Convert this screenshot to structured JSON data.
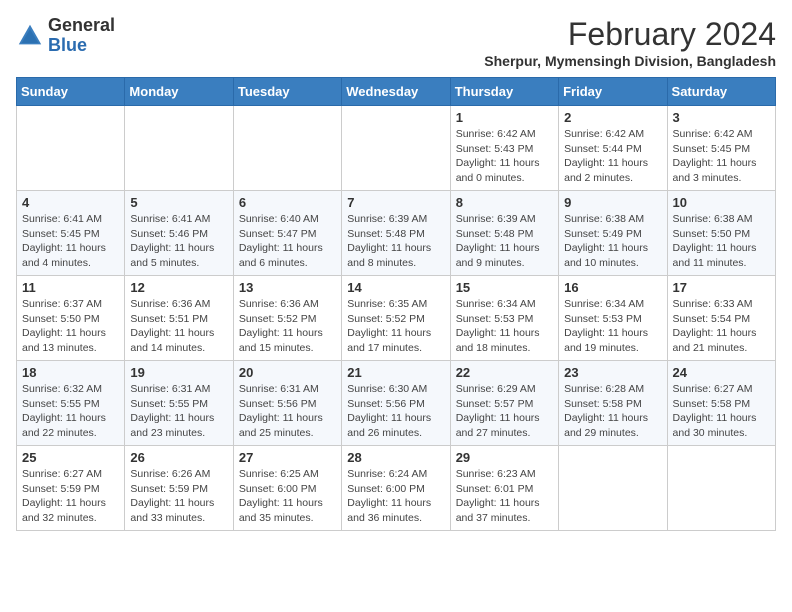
{
  "header": {
    "logo": {
      "line1": "General",
      "line2": "Blue"
    },
    "title": "February 2024",
    "location": "Sherpur, Mymensingh Division, Bangladesh"
  },
  "days_of_week": [
    "Sunday",
    "Monday",
    "Tuesday",
    "Wednesday",
    "Thursday",
    "Friday",
    "Saturday"
  ],
  "weeks": [
    [
      {
        "day": "",
        "info": ""
      },
      {
        "day": "",
        "info": ""
      },
      {
        "day": "",
        "info": ""
      },
      {
        "day": "",
        "info": ""
      },
      {
        "day": "1",
        "info": "Sunrise: 6:42 AM\nSunset: 5:43 PM\nDaylight: 11 hours\nand 0 minutes."
      },
      {
        "day": "2",
        "info": "Sunrise: 6:42 AM\nSunset: 5:44 PM\nDaylight: 11 hours\nand 2 minutes."
      },
      {
        "day": "3",
        "info": "Sunrise: 6:42 AM\nSunset: 5:45 PM\nDaylight: 11 hours\nand 3 minutes."
      }
    ],
    [
      {
        "day": "4",
        "info": "Sunrise: 6:41 AM\nSunset: 5:45 PM\nDaylight: 11 hours\nand 4 minutes."
      },
      {
        "day": "5",
        "info": "Sunrise: 6:41 AM\nSunset: 5:46 PM\nDaylight: 11 hours\nand 5 minutes."
      },
      {
        "day": "6",
        "info": "Sunrise: 6:40 AM\nSunset: 5:47 PM\nDaylight: 11 hours\nand 6 minutes."
      },
      {
        "day": "7",
        "info": "Sunrise: 6:39 AM\nSunset: 5:48 PM\nDaylight: 11 hours\nand 8 minutes."
      },
      {
        "day": "8",
        "info": "Sunrise: 6:39 AM\nSunset: 5:48 PM\nDaylight: 11 hours\nand 9 minutes."
      },
      {
        "day": "9",
        "info": "Sunrise: 6:38 AM\nSunset: 5:49 PM\nDaylight: 11 hours\nand 10 minutes."
      },
      {
        "day": "10",
        "info": "Sunrise: 6:38 AM\nSunset: 5:50 PM\nDaylight: 11 hours\nand 11 minutes."
      }
    ],
    [
      {
        "day": "11",
        "info": "Sunrise: 6:37 AM\nSunset: 5:50 PM\nDaylight: 11 hours\nand 13 minutes."
      },
      {
        "day": "12",
        "info": "Sunrise: 6:36 AM\nSunset: 5:51 PM\nDaylight: 11 hours\nand 14 minutes."
      },
      {
        "day": "13",
        "info": "Sunrise: 6:36 AM\nSunset: 5:52 PM\nDaylight: 11 hours\nand 15 minutes."
      },
      {
        "day": "14",
        "info": "Sunrise: 6:35 AM\nSunset: 5:52 PM\nDaylight: 11 hours\nand 17 minutes."
      },
      {
        "day": "15",
        "info": "Sunrise: 6:34 AM\nSunset: 5:53 PM\nDaylight: 11 hours\nand 18 minutes."
      },
      {
        "day": "16",
        "info": "Sunrise: 6:34 AM\nSunset: 5:53 PM\nDaylight: 11 hours\nand 19 minutes."
      },
      {
        "day": "17",
        "info": "Sunrise: 6:33 AM\nSunset: 5:54 PM\nDaylight: 11 hours\nand 21 minutes."
      }
    ],
    [
      {
        "day": "18",
        "info": "Sunrise: 6:32 AM\nSunset: 5:55 PM\nDaylight: 11 hours\nand 22 minutes."
      },
      {
        "day": "19",
        "info": "Sunrise: 6:31 AM\nSunset: 5:55 PM\nDaylight: 11 hours\nand 23 minutes."
      },
      {
        "day": "20",
        "info": "Sunrise: 6:31 AM\nSunset: 5:56 PM\nDaylight: 11 hours\nand 25 minutes."
      },
      {
        "day": "21",
        "info": "Sunrise: 6:30 AM\nSunset: 5:56 PM\nDaylight: 11 hours\nand 26 minutes."
      },
      {
        "day": "22",
        "info": "Sunrise: 6:29 AM\nSunset: 5:57 PM\nDaylight: 11 hours\nand 27 minutes."
      },
      {
        "day": "23",
        "info": "Sunrise: 6:28 AM\nSunset: 5:58 PM\nDaylight: 11 hours\nand 29 minutes."
      },
      {
        "day": "24",
        "info": "Sunrise: 6:27 AM\nSunset: 5:58 PM\nDaylight: 11 hours\nand 30 minutes."
      }
    ],
    [
      {
        "day": "25",
        "info": "Sunrise: 6:27 AM\nSunset: 5:59 PM\nDaylight: 11 hours\nand 32 minutes."
      },
      {
        "day": "26",
        "info": "Sunrise: 6:26 AM\nSunset: 5:59 PM\nDaylight: 11 hours\nand 33 minutes."
      },
      {
        "day": "27",
        "info": "Sunrise: 6:25 AM\nSunset: 6:00 PM\nDaylight: 11 hours\nand 35 minutes."
      },
      {
        "day": "28",
        "info": "Sunrise: 6:24 AM\nSunset: 6:00 PM\nDaylight: 11 hours\nand 36 minutes."
      },
      {
        "day": "29",
        "info": "Sunrise: 6:23 AM\nSunset: 6:01 PM\nDaylight: 11 hours\nand 37 minutes."
      },
      {
        "day": "",
        "info": ""
      },
      {
        "day": "",
        "info": ""
      }
    ]
  ]
}
